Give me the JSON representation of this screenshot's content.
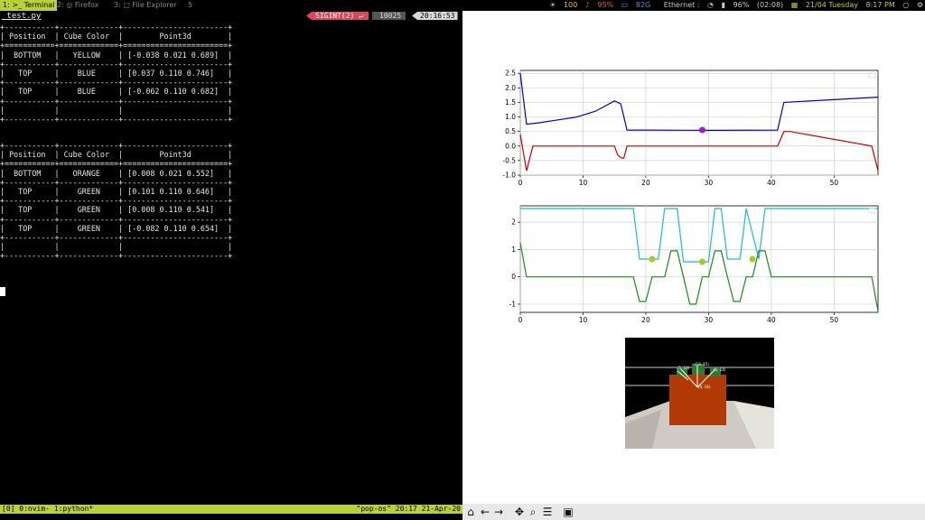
{
  "topbar": {
    "workspaces": [
      "1: >_ Terminal",
      "2: ◎ Firefox",
      "3: ▢ File Explorer",
      "5"
    ],
    "status": {
      "brightness": "100",
      "volume": "95%",
      "disk": "82G",
      "network": "Ethernet :",
      "battery": "96%",
      "battery_time": "(02:08)",
      "date": "21/04 Tuesday",
      "time": "8:17 PM"
    }
  },
  "terminal": {
    "filename": "_test.py",
    "sigint": "SIGINT(2) ↵",
    "pid": "10025",
    "clock": "20:16:53",
    "table1": "+-----------+-------------+-----------------------+\n| Position  | Cube Color  |        Point3d        |\n+===========+=============+=======================+\n|  BOTTOM   |   YELLOW    | [-0.038 0.021 0.689]  |\n+-----------+-------------+-----------------------+\n|   TOP     |    BLUE     | [0.037 0.110 0.746]   |\n+-----------+-------------+-----------------------+\n|   TOP     |    BLUE     | [-0.062 0.110 0.682]  |\n+-----------+-------------+-----------------------+\n|           |             |                       |\n+-----------+-------------+-----------------------+",
    "table2": "+-----------+-------------+-----------------------+\n| Position  | Cube Color  |        Point3d        |\n+===========+=============+=======================+\n|  BOTTOM   |   ORANGE    | [0.008 0.021 0.552]   |\n+-----------+-------------+-----------------------+\n|   TOP     |    GREEN    | [0.101 0.110 0.646]   |\n+-----------+-------------+-----------------------+\n|   TOP     |    GREEN    | [0.008 0.110 0.541]   |\n+-----------+-------------+-----------------------+\n|   TOP     |    GREEN    | [-0.082 0.110 0.654]  |\n+-----------+-------------+-----------------------+\n|           |             |                       |\n+-----------+-------------+-----------------------+",
    "tmux_left": "[0] 0:nvim- 1:python*",
    "tmux_right": "\"pop-os\" 20:17 21-Apr-20"
  },
  "figure": {
    "camera_labels": [
      "(18, 15)",
      "(5, 14)",
      "(5, 14)",
      "(0, 24)"
    ]
  },
  "toolbar": {
    "icons": [
      "home-icon",
      "back-icon",
      "forward-icon",
      "pan-icon",
      "zoom-icon",
      "configure-icon",
      "save-icon"
    ]
  },
  "chart_data": [
    {
      "type": "line",
      "xlim": [
        0,
        57
      ],
      "ylim": [
        -1.0,
        2.6
      ],
      "xticks": [
        "0",
        "10",
        "20",
        "30",
        "40",
        "50"
      ],
      "yticks": [
        "-1.0",
        "-0.5",
        "0.0",
        "0.5",
        "1.0",
        "1.5",
        "2.0",
        "2.5"
      ],
      "grid": true,
      "series": [
        {
          "color": "#0000cc",
          "x": [
            0,
            1,
            3,
            6,
            9,
            12,
            15,
            16,
            17,
            20,
            30,
            41,
            42,
            57
          ],
          "y": [
            2.5,
            0.75,
            0.8,
            0.9,
            1.0,
            1.2,
            1.55,
            1.45,
            0.55,
            0.55,
            0.54,
            0.55,
            1.5,
            1.68
          ]
        },
        {
          "color": "#cc0000",
          "x": [
            0,
            1,
            2,
            15,
            15.5,
            16,
            16.5,
            17,
            41,
            42,
            43,
            56,
            57
          ],
          "y": [
            0.4,
            -0.85,
            0.0,
            0.0,
            -0.3,
            -0.4,
            -0.42,
            0.0,
            0.0,
            0.5,
            0.5,
            0.0,
            -0.85
          ]
        }
      ],
      "markers": [
        {
          "x": 29,
          "y": 0.55,
          "color": "#9a1fcf"
        }
      ]
    },
    {
      "type": "line",
      "xlim": [
        0,
        57
      ],
      "ylim": [
        -1.3,
        2.6
      ],
      "xticks": [
        "0",
        "10",
        "20",
        "30",
        "40",
        "50"
      ],
      "yticks": [
        "-1",
        "0",
        "1",
        "2"
      ],
      "grid": true,
      "series": [
        {
          "color": "#17becf",
          "x": [
            0,
            18,
            19,
            22,
            23,
            25,
            26,
            27,
            28,
            30,
            31,
            32,
            33,
            35,
            36,
            38,
            39,
            57
          ],
          "y": [
            2.5,
            2.5,
            0.65,
            0.65,
            2.5,
            2.5,
            0.55,
            0.55,
            0.55,
            0.55,
            2.5,
            2.5,
            0.65,
            0.65,
            2.5,
            0.65,
            2.5,
            2.5
          ]
        },
        {
          "color": "#1a8a1a",
          "x": [
            0,
            1,
            18,
            19,
            20,
            21,
            23,
            24,
            25,
            26,
            27,
            28,
            29,
            30,
            31,
            32,
            33,
            34,
            35,
            36,
            37,
            38,
            39,
            40,
            41,
            56,
            57
          ],
          "y": [
            1.25,
            0.0,
            0.0,
            -0.9,
            -0.9,
            0.0,
            0.0,
            0.95,
            0.95,
            0.0,
            -1.0,
            -1.0,
            0.0,
            0.0,
            0.95,
            0.95,
            0.0,
            -0.9,
            -0.9,
            0.0,
            0.0,
            0.95,
            0.95,
            0.0,
            0.0,
            0.0,
            -1.25
          ]
        }
      ],
      "markers": [
        {
          "x": 21,
          "y": 0.65,
          "color": "#a8c92a"
        },
        {
          "x": 29,
          "y": 0.55,
          "color": "#a8c92a"
        },
        {
          "x": 37,
          "y": 0.65,
          "color": "#a8c92a"
        }
      ]
    }
  ]
}
